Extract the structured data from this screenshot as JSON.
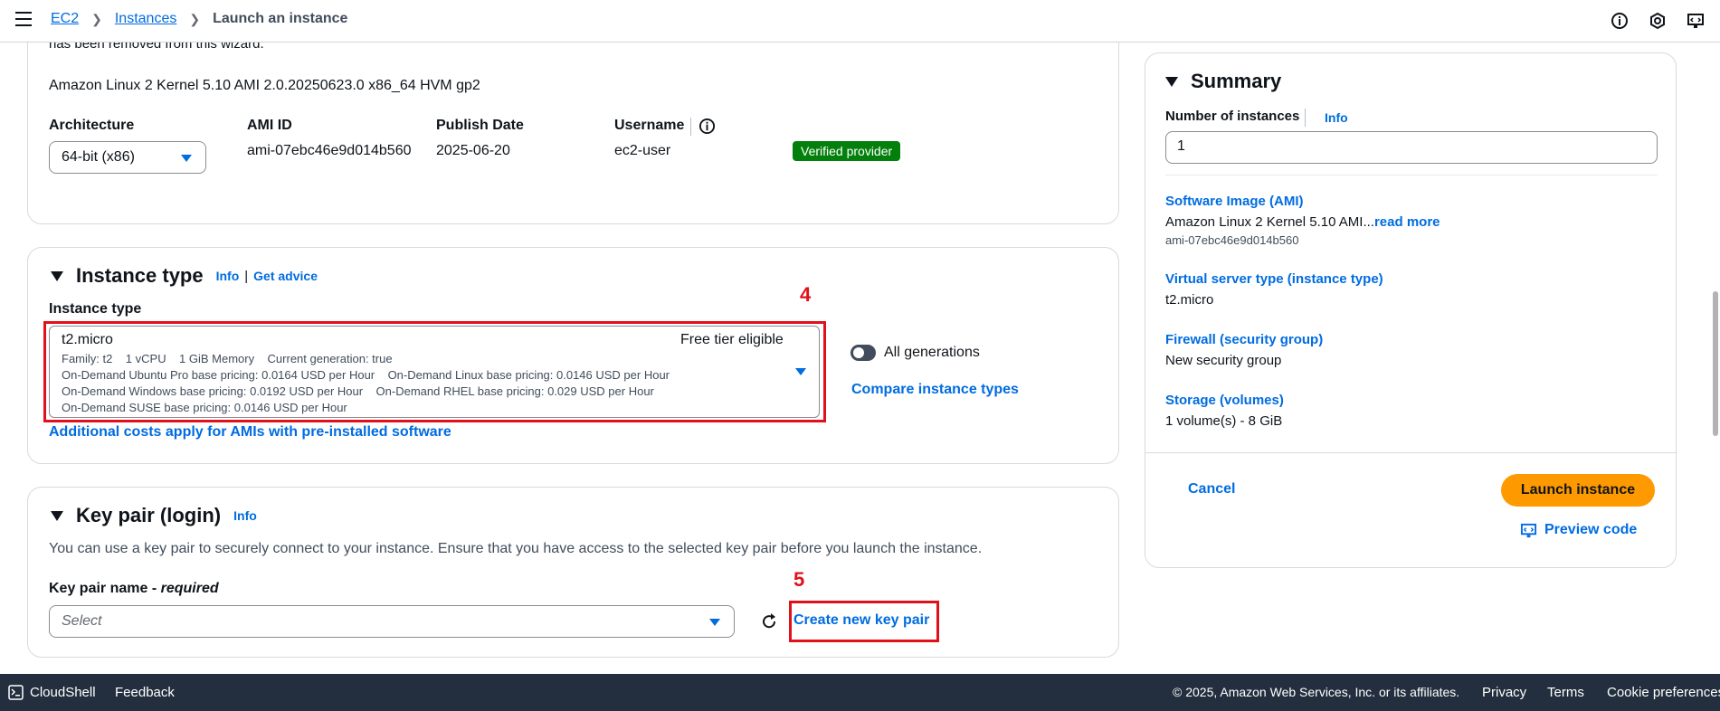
{
  "breadcrumb": {
    "ec2": "EC2",
    "instances": "Instances",
    "current": "Launch an instance"
  },
  "ami": {
    "partial_line": "has been removed from this wizard.",
    "name": "Amazon Linux 2 Kernel 5.10 AMI 2.0.20250623.0 x86_64 HVM gp2",
    "architecture_label": "Architecture",
    "architecture_value": "64-bit (x86)",
    "ami_id_label": "AMI ID",
    "ami_id_value": "ami-07ebc46e9d014b560",
    "publish_date_label": "Publish Date",
    "publish_date_value": "2025-06-20",
    "username_label": "Username",
    "username_value": "ec2-user",
    "verified_badge": "Verified provider"
  },
  "instance_type": {
    "title": "Instance type",
    "info": "Info",
    "separator": "|",
    "get_advice": "Get advice",
    "field_label": "Instance type",
    "selected": "t2.micro",
    "free_tier": "Free tier eligible",
    "details_line1": "Family: t2    1 vCPU    1 GiB Memory    Current generation: true",
    "details_line2": "On-Demand Ubuntu Pro base pricing: 0.0164 USD per Hour    On-Demand Linux base pricing: 0.0146 USD per Hour",
    "details_line3": "On-Demand Windows base pricing: 0.0192 USD per Hour    On-Demand RHEL base pricing: 0.029 USD per Hour",
    "details_line4": "On-Demand SUSE base pricing: 0.0146 USD per Hour",
    "all_generations": "All generations",
    "compare": "Compare instance types",
    "additional_costs": "Additional costs apply for AMIs with pre-installed software",
    "annotation": "4"
  },
  "key_pair": {
    "title": "Key pair (login)",
    "info": "Info",
    "description": "You can use a key pair to securely connect to your instance. Ensure that you have access to the selected key pair before you launch the instance.",
    "field_label": "Key pair name - ",
    "required": "required",
    "placeholder": "Select",
    "create": "Create new key pair",
    "annotation": "5"
  },
  "summary": {
    "title": "Summary",
    "num_instances_label": "Number of instances",
    "info": "Info",
    "num_instances_value": "1",
    "software_image_label": "Software Image (AMI)",
    "software_image_value": "Amazon Linux 2 Kernel 5.10 AMI...",
    "read_more": "read more",
    "software_image_id": "ami-07ebc46e9d014b560",
    "server_type_label": "Virtual server type (instance type)",
    "server_type_value": "t2.micro",
    "firewall_label": "Firewall (security group)",
    "firewall_value": "New security group",
    "storage_label": "Storage (volumes)",
    "storage_value": "1 volume(s) - 8 GiB",
    "cancel": "Cancel",
    "launch": "Launch instance",
    "preview_code": "Preview code"
  },
  "footer": {
    "cloudshell": "CloudShell",
    "feedback": "Feedback",
    "copyright": "© 2025, Amazon Web Services, Inc. or its affiliates.",
    "privacy": "Privacy",
    "terms": "Terms",
    "cookies": "Cookie preferences"
  },
  "colors": {
    "link": "#006ce0",
    "launch": "#ff9900",
    "badge": "#037f0c",
    "annotation": "#e0111a",
    "footer": "#232f3e"
  }
}
